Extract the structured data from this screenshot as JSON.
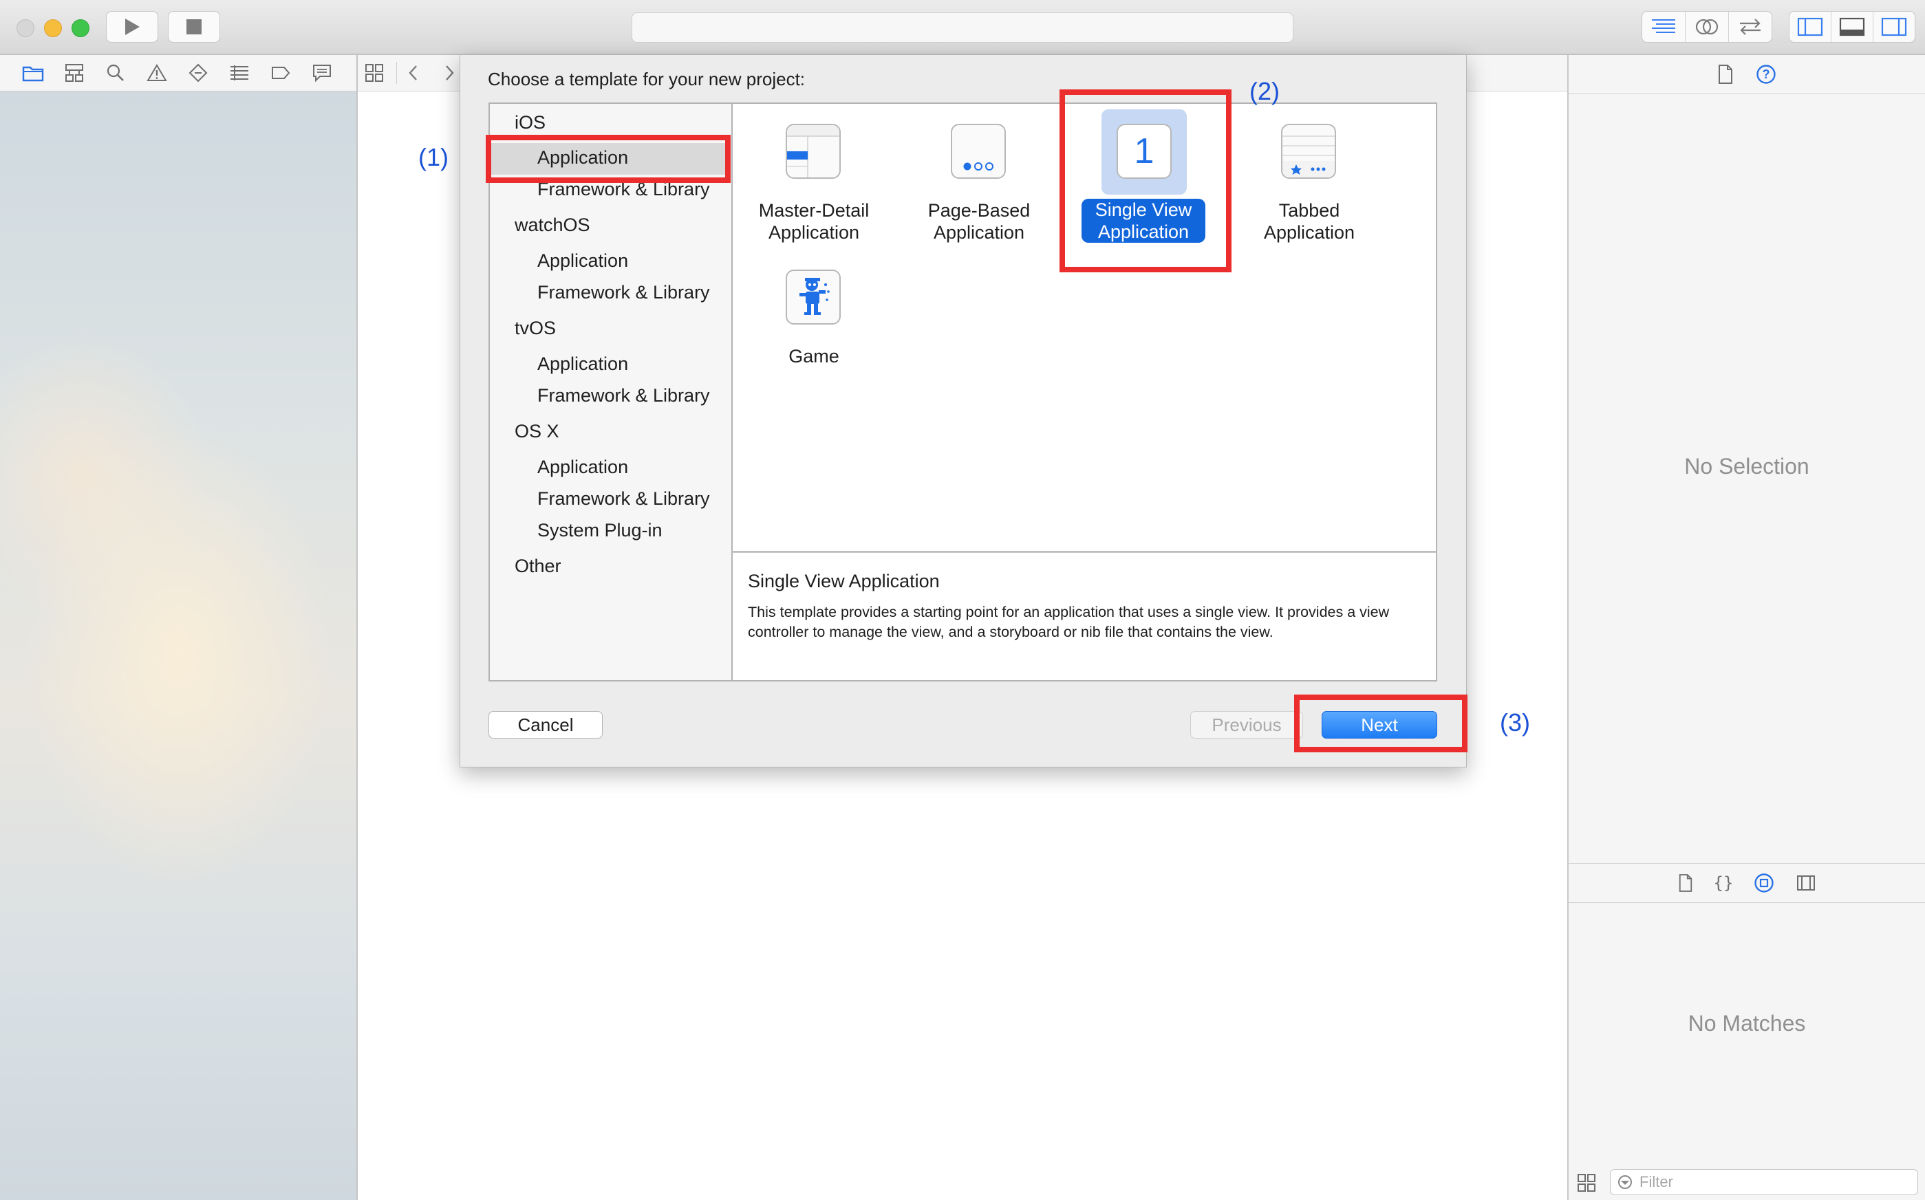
{
  "window": {
    "title": ""
  },
  "colors": {
    "accent": "#1266db",
    "annotation_red": "#ec2d2d",
    "annotation_blue": "#1a52d6"
  },
  "toolbar": {
    "run_icon": "play-icon",
    "stop_icon": "stop-icon",
    "activity_text": ""
  },
  "navigator": {
    "icons": [
      "folder-icon",
      "symbol-hierarchy-icon",
      "search-icon",
      "warning-icon",
      "test-diamond-icon",
      "debug-list-icon",
      "breakpoint-icon",
      "report-bubble-icon"
    ]
  },
  "sheet": {
    "title": "Choose a template for your new project:",
    "categories": [
      {
        "name": "iOS",
        "items": [
          "Application",
          "Framework & Library"
        ]
      },
      {
        "name": "watchOS",
        "items": [
          "Application",
          "Framework & Library"
        ]
      },
      {
        "name": "tvOS",
        "items": [
          "Application",
          "Framework & Library"
        ]
      },
      {
        "name": "OS X",
        "items": [
          "Application",
          "Framework & Library",
          "System Plug-in"
        ]
      },
      {
        "name": "Other",
        "items": []
      }
    ],
    "selected_category": "iOS / Application",
    "templates": [
      {
        "label_line1": "Master-Detail",
        "label_line2": "Application",
        "icon": "master-detail-icon"
      },
      {
        "label_line1": "Page-Based",
        "label_line2": "Application",
        "icon": "page-based-icon"
      },
      {
        "label_line1": "Single View",
        "label_line2": "Application",
        "icon": "single-view-icon",
        "icon_glyph": "1",
        "selected": true
      },
      {
        "label_line1": "Tabbed",
        "label_line2": "Application",
        "icon": "tabbed-icon"
      },
      {
        "label_line1": "Game",
        "label_line2": "",
        "icon": "game-icon"
      }
    ],
    "description": {
      "title": "Single View Application",
      "text": "This template provides a starting point for an application that uses a single view. It provides a view controller to manage the view, and a storyboard or nib file that contains the view."
    },
    "buttons": {
      "cancel": "Cancel",
      "previous": "Previous",
      "next": "Next"
    }
  },
  "inspector": {
    "no_selection": "No Selection",
    "no_matches": "No Matches",
    "filter_placeholder": "Filter"
  },
  "annotations": {
    "step1": "(1)",
    "step2": "(2)",
    "step3": "(3)"
  }
}
